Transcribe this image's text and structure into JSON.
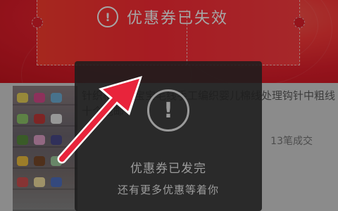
{
  "coupon_banner": {
    "status_text": "优惠券已失效",
    "icon": "exclamation-circle-icon"
  },
  "product": {
    "title": "针织棉线绒宝宝毛线手工编织婴儿棉线处理钩针中粗线十个包邮",
    "sales": "13笔成交"
  },
  "toast": {
    "icon": "exclamation-circle-icon",
    "title": "优惠券已发完",
    "subtitle": "还有更多优惠等着你"
  },
  "annotation": {
    "arrow_color": "#e8243b",
    "arrow_icon": "red-arrow-icon"
  },
  "colors": {
    "banner_red": "#e51f2c",
    "toast_bg": "#1c1c1c",
    "toast_text": "#9c9c9c"
  }
}
